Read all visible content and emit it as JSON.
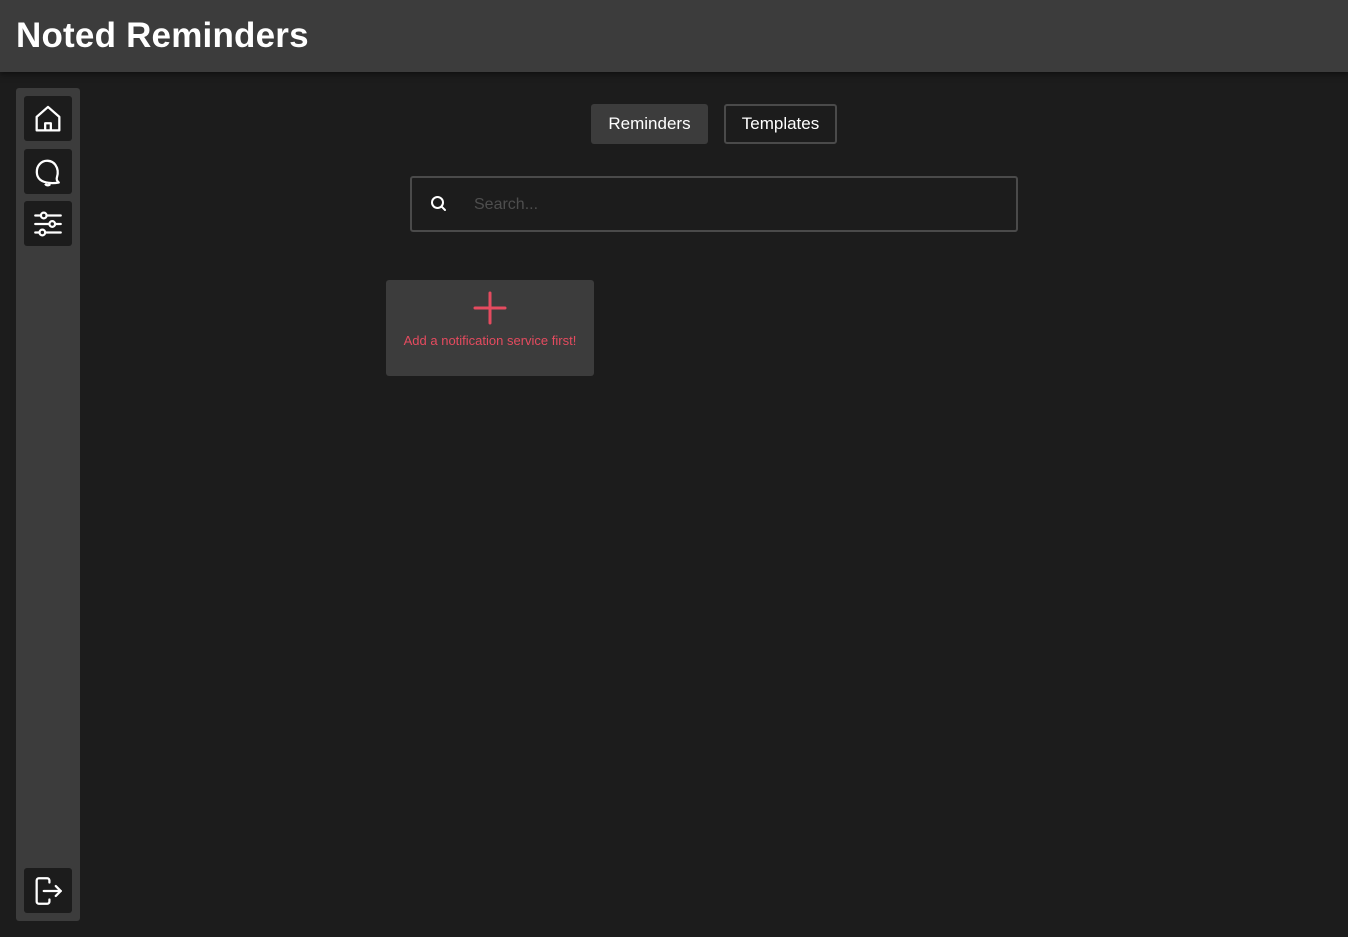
{
  "app": {
    "title": "Noted Reminders"
  },
  "sidebar": {
    "items": [
      {
        "icon": "home-icon"
      },
      {
        "icon": "bell-icon"
      },
      {
        "icon": "sliders-icon"
      },
      {
        "icon": "logout-icon"
      }
    ]
  },
  "tabs": [
    {
      "label": "Reminders",
      "active": true
    },
    {
      "label": "Templates",
      "active": false
    }
  ],
  "search": {
    "placeholder": "Search...",
    "value": ""
  },
  "add_card": {
    "text": "Add a notification service first!",
    "icon": "plus-icon"
  },
  "colors": {
    "background": "#1c1c1c",
    "panel": "#3c3c3c",
    "border": "#4a4a4a",
    "accent": "#e54b5f",
    "text": "#ffffff"
  }
}
